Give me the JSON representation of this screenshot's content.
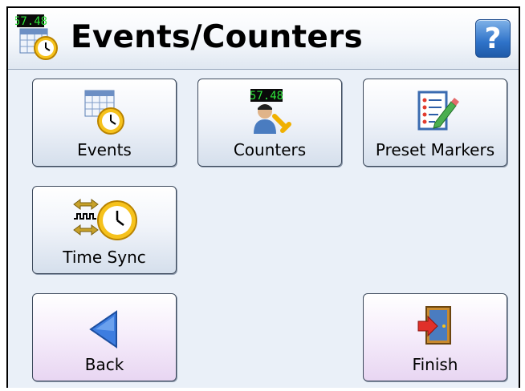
{
  "header": {
    "title": "Events/Counters",
    "app_icon": "calendar-clock-icon",
    "icon_badge": "57.48",
    "help_label": "?"
  },
  "buttons": {
    "events": {
      "label": "Events",
      "icon": "calendar-clock-icon"
    },
    "counters": {
      "label": "Counters",
      "icon": "user-wrench-counter-icon",
      "badge": "57.48"
    },
    "preset_markers": {
      "label": "Preset Markers",
      "icon": "list-pencil-icon"
    },
    "time_sync": {
      "label": "Time Sync",
      "icon": "sync-clock-icon"
    }
  },
  "nav": {
    "back": {
      "label": "Back",
      "icon": "back-arrow-icon"
    },
    "finish": {
      "label": "Finish",
      "icon": "exit-door-icon"
    }
  },
  "colors": {
    "background": "#eaf0f8",
    "button_gradient_bottom": "#d5dfec",
    "nav_button_gradient_bottom": "#e8d6f2",
    "help_blue": "#2f73c9",
    "badge_green": "#22c22a"
  }
}
